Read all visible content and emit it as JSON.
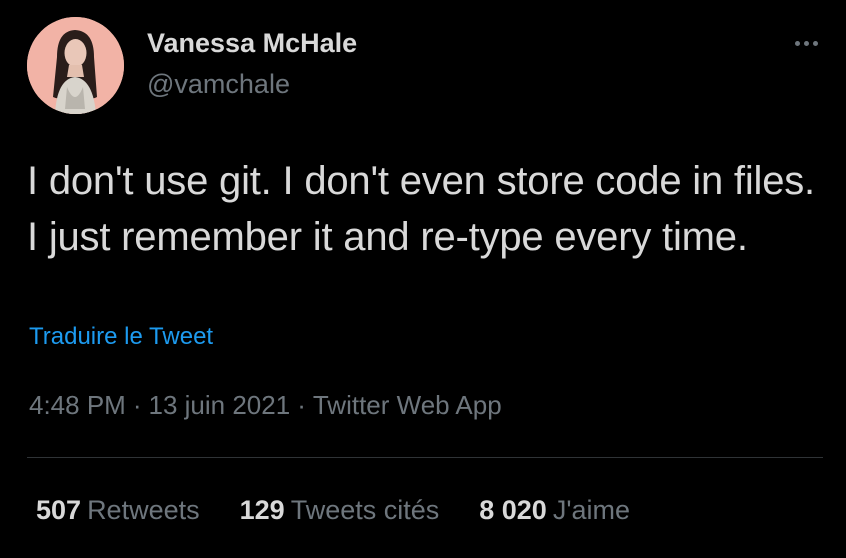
{
  "author": {
    "display_name": "Vanessa McHale",
    "handle": "@vamchale",
    "avatar_icon": "profile-photo"
  },
  "more_icon": "more-dots-icon",
  "tweet": {
    "text": "I don't use git. I don't even store code in files. I just remember it and re-type every time.",
    "translate_label": "Traduire le Tweet"
  },
  "meta": {
    "time": "4:48 PM",
    "separator": "·",
    "date": "13 juin 2021",
    "source": "Twitter Web App"
  },
  "stats": {
    "retweets_count": "507",
    "retweets_label": "Retweets",
    "quotes_count": "129",
    "quotes_label": "Tweets cités",
    "likes_count": "8 020",
    "likes_label": "J'aime"
  },
  "colors": {
    "background": "#000000",
    "text": "#d9d9d9",
    "secondary": "#6e767d",
    "link": "#1d9bf0",
    "avatar_bg": "#f2b3a6"
  }
}
